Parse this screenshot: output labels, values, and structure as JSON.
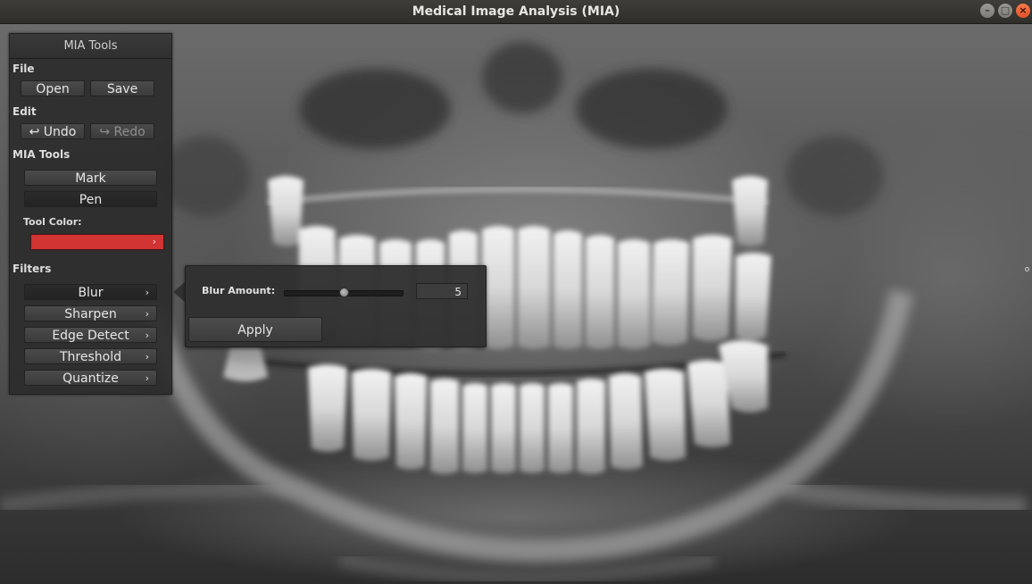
{
  "window": {
    "title": "Medical Image Analysis (MIA)",
    "controls": [
      "minimize-icon",
      "maximize-icon",
      "close-icon"
    ],
    "close_color": "#e1522a"
  },
  "panel": {
    "header": "MIA Tools",
    "file": {
      "label": "File",
      "open": "Open",
      "save": "Save"
    },
    "edit": {
      "label": "Edit",
      "undo": "Undo",
      "redo": "Redo"
    },
    "tools": {
      "label": "MIA Tools",
      "mark": "Mark",
      "pen": "Pen",
      "tool_color_label": "Tool Color:",
      "tool_color": "#d13433"
    },
    "filters": {
      "label": "Filters",
      "items": [
        {
          "label": "Blur",
          "active": true
        },
        {
          "label": "Sharpen"
        },
        {
          "label": "Edge Detect"
        },
        {
          "label": "Threshold"
        },
        {
          "label": "Quantize"
        }
      ]
    }
  },
  "blur_popup": {
    "label": "Blur Amount:",
    "value": "5",
    "slider_fraction": 0.5,
    "apply": "Apply"
  }
}
